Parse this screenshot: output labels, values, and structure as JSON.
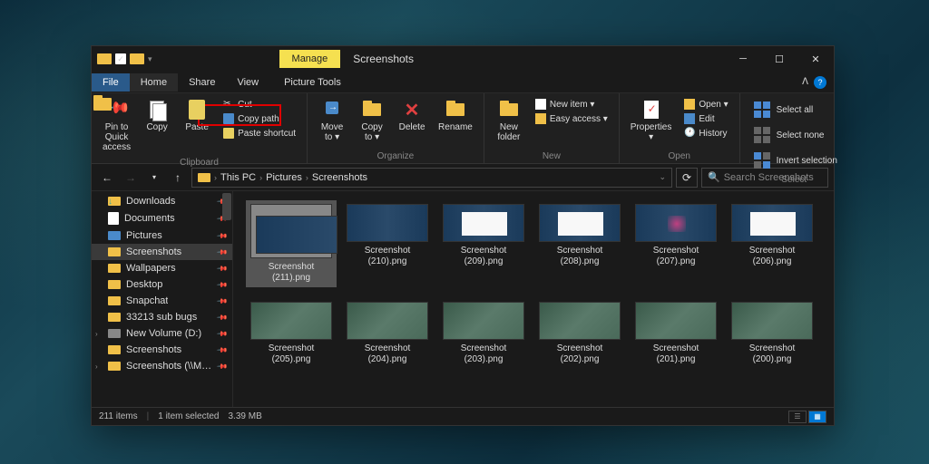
{
  "window": {
    "manage_tab": "Manage",
    "title": "Screenshots"
  },
  "menu": {
    "file": "File",
    "home": "Home",
    "share": "Share",
    "view": "View",
    "picture_tools": "Picture Tools"
  },
  "ribbon": {
    "clipboard": {
      "label": "Clipboard",
      "pin": "Pin to Quick\naccess",
      "copy": "Copy",
      "paste": "Paste",
      "cut": "Cut",
      "copy_path": "Copy path",
      "paste_shortcut": "Paste shortcut"
    },
    "organize": {
      "label": "Organize",
      "move_to": "Move\nto ▾",
      "copy_to": "Copy\nto ▾",
      "delete": "Delete",
      "rename": "Rename"
    },
    "new": {
      "label": "New",
      "new_folder": "New\nfolder",
      "new_item": "New item ▾",
      "easy_access": "Easy access ▾"
    },
    "open": {
      "label": "Open",
      "properties": "Properties\n▾",
      "open": "Open ▾",
      "edit": "Edit",
      "history": "History"
    },
    "select": {
      "label": "Select",
      "select_all": "Select all",
      "select_none": "Select none",
      "invert": "Invert selection"
    }
  },
  "breadcrumb": {
    "this_pc": "This PC",
    "pictures": "Pictures",
    "screenshots": "Screenshots"
  },
  "search": {
    "placeholder": "Search Screenshots"
  },
  "sidebar": {
    "items": [
      {
        "label": "Downloads",
        "icon": "dl",
        "pin": true
      },
      {
        "label": "Documents",
        "icon": "doc",
        "pin": true
      },
      {
        "label": "Pictures",
        "icon": "pic",
        "pin": true
      },
      {
        "label": "Screenshots",
        "icon": "folder",
        "pin": true,
        "selected": true
      },
      {
        "label": "Wallpapers",
        "icon": "folder",
        "pin": true
      },
      {
        "label": "Desktop",
        "icon": "folder",
        "pin": true
      },
      {
        "label": "Snapchat",
        "icon": "folder",
        "pin": true
      },
      {
        "label": "33213 sub bugs",
        "icon": "folder",
        "pin": true
      },
      {
        "label": "New Volume (D:)",
        "icon": "drive",
        "pin": true,
        "expandable": true
      },
      {
        "label": "Screenshots",
        "icon": "folder",
        "pin": true
      },
      {
        "label": "Screenshots (\\\\MACBOOK",
        "icon": "folder",
        "pin": true,
        "expandable": true
      }
    ]
  },
  "files": [
    {
      "name": "Screenshot (211).png",
      "selected": true,
      "thumb": "sel"
    },
    {
      "name": "Screenshot (210).png",
      "thumb": "dark"
    },
    {
      "name": "Screenshot (209).png",
      "thumb": "light"
    },
    {
      "name": "Screenshot (208).png",
      "thumb": "light"
    },
    {
      "name": "Screenshot (207).png",
      "thumb": "pink"
    },
    {
      "name": "Screenshot (206).png",
      "thumb": "light"
    },
    {
      "name": "Screenshot (205).png",
      "thumb": "natural"
    },
    {
      "name": "Screenshot (204).png",
      "thumb": "natural"
    },
    {
      "name": "Screenshot (203).png",
      "thumb": "natural"
    },
    {
      "name": "Screenshot (202).png",
      "thumb": "natural"
    },
    {
      "name": "Screenshot (201).png",
      "thumb": "natural"
    },
    {
      "name": "Screenshot (200).png",
      "thumb": "natural"
    }
  ],
  "status": {
    "count": "211 items",
    "selected": "1 item selected",
    "size": "3.39 MB"
  }
}
